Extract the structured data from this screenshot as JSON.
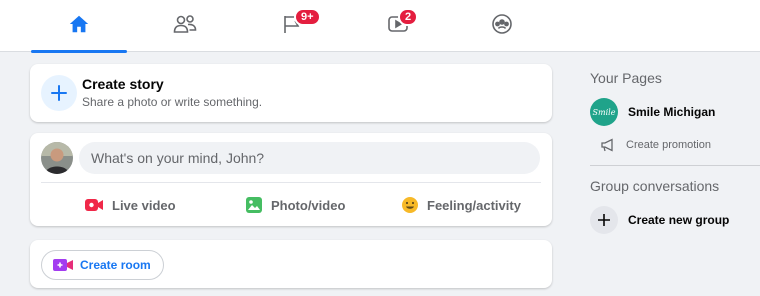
{
  "nav": {
    "tabs": [
      {
        "id": "home",
        "icon": "home-icon",
        "active": true,
        "badge": ""
      },
      {
        "id": "friends",
        "icon": "friends-icon",
        "active": false,
        "badge": ""
      },
      {
        "id": "pages",
        "icon": "flag-icon",
        "active": false,
        "badge": "9+"
      },
      {
        "id": "watch",
        "icon": "video-icon",
        "active": false,
        "badge": "2"
      },
      {
        "id": "groups",
        "icon": "groups-icon",
        "active": false,
        "badge": ""
      }
    ],
    "accent_color": "#1877f2",
    "badge_color": "#e41e3f"
  },
  "story": {
    "title": "Create story",
    "subtitle": "Share a photo or write something."
  },
  "composer": {
    "placeholder": "What's on your mind, John?",
    "actions": [
      {
        "label": "Live video",
        "icon": "live-video-icon",
        "color": "#f02849"
      },
      {
        "label": "Photo/video",
        "icon": "photo-icon",
        "color": "#45bd62"
      },
      {
        "label": "Feeling/activity",
        "icon": "feeling-icon",
        "color": "#f7b928"
      }
    ]
  },
  "room": {
    "label": "Create room",
    "icon": "room-video-icon"
  },
  "sidebar": {
    "pages_title": "Your Pages",
    "page_name": "Smile Michigan",
    "page_logo_text": "Smile",
    "promotion_label": "Create promotion",
    "groups_title": "Group conversations",
    "new_group_label": "Create new group"
  }
}
